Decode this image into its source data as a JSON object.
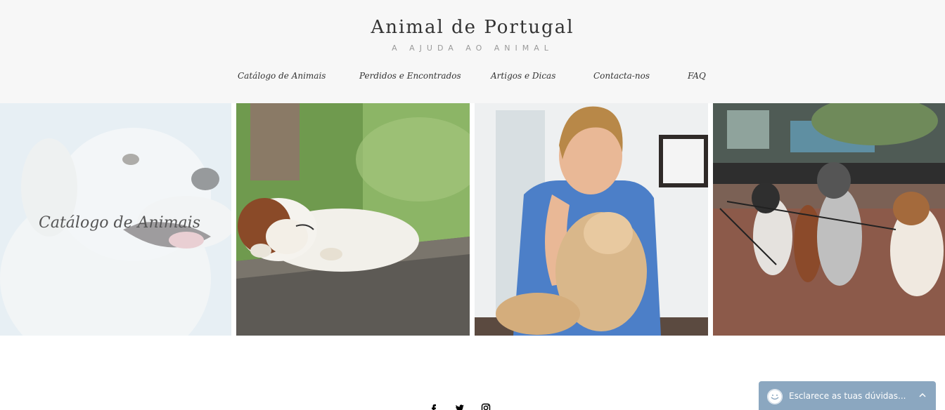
{
  "header": {
    "title": "Animal de Portugal",
    "tagline": "A AJUDA AO ANIMAL"
  },
  "nav": {
    "items": [
      {
        "label": "Catálogo de Animais"
      },
      {
        "label": "Perdidos e Encontrados"
      },
      {
        "label": "Artigos e Dicas"
      },
      {
        "label": "Contacta-nos"
      },
      {
        "label": "FAQ"
      }
    ]
  },
  "gallery": {
    "tiles": [
      {
        "image": "white-dog-photo",
        "caption": "Catálogo de Animais"
      },
      {
        "image": "sleeping-puppy-photo"
      },
      {
        "image": "vet-with-dog-photo"
      },
      {
        "image": "dogs-on-leash-photo"
      }
    ]
  },
  "social": {
    "icons": [
      "facebook-icon",
      "twitter-icon",
      "instagram-icon"
    ]
  },
  "chat": {
    "text": "Esclarece as tuas dúvidas...",
    "color": "#8ba7c0"
  },
  "colors": {
    "header_bg": "#f7f7f7",
    "text": "#333333",
    "tagline": "#9a9a9a"
  }
}
